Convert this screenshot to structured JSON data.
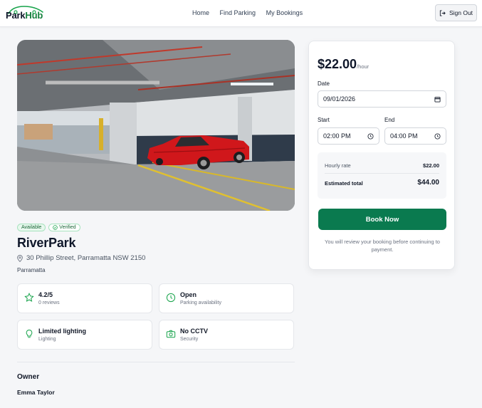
{
  "nav": {
    "brand_park": "Park",
    "brand_hub": "Hub",
    "links": [
      "Home",
      "Find Parking",
      "My Bookings"
    ],
    "sign_out": "Sign Out"
  },
  "listing": {
    "badges": {
      "available": "Available",
      "verified": "Verified"
    },
    "title": "RiverPark",
    "address": "30 Phillip Street, Parramatta NSW 2150",
    "suburb": "Parramatta",
    "stats": [
      {
        "icon": "star-icon",
        "main": "4.2/5",
        "sub": "0 reviews"
      },
      {
        "icon": "clock-icon",
        "main": "Open",
        "sub": "Parking availability"
      },
      {
        "icon": "bulb-icon",
        "main": "Limited lighting",
        "sub": "Lighting"
      },
      {
        "icon": "camera-icon",
        "main": "No CCTV",
        "sub": "Security"
      }
    ],
    "owner_heading": "Owner",
    "owner_name": "Emma Taylor"
  },
  "booking": {
    "price": "$22.00",
    "price_unit": "/hour",
    "date_label": "Date",
    "date_value": "09/01/2026",
    "start_label": "Start",
    "start_value": "02:00 PM",
    "end_label": "End",
    "end_value": "04:00 PM",
    "hourly_rate_label": "Hourly rate",
    "hourly_rate_value": "$22.00",
    "estimated_total_label": "Estimated total",
    "estimated_total_value": "$44.00",
    "book_button": "Book Now",
    "note": "You will review your booking before continuing to payment."
  },
  "colors": {
    "accent": "#0a7a4f",
    "brand_green": "#15803d",
    "badge_bg": "#e8f8ee",
    "icon_green": "#16a34a",
    "car_red": "#d0171b"
  }
}
